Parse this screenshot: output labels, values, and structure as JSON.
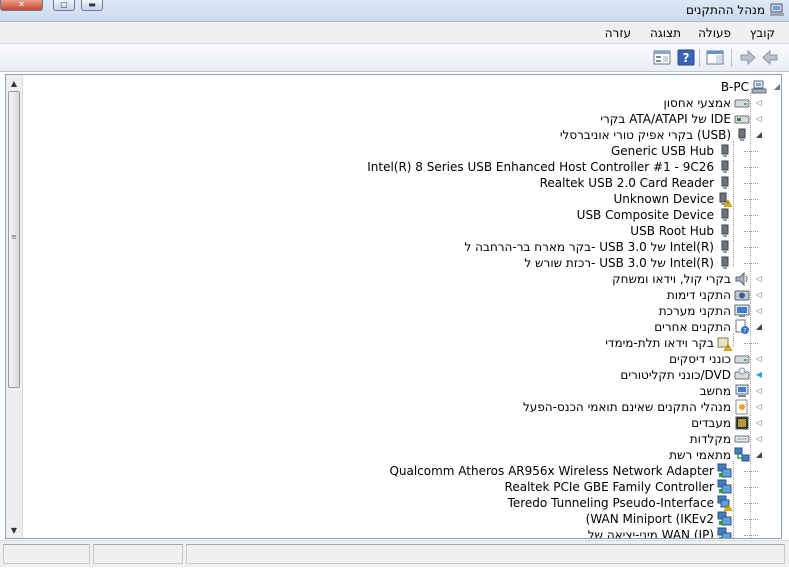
{
  "window": {
    "title": "מנהל ההתקנים",
    "icons": {
      "app": "device-manager-icon",
      "close": "close-icon",
      "maximize": "maximize-icon",
      "minimize": "minimize-icon"
    }
  },
  "menu": {
    "file": "קובץ",
    "action": "פעולה",
    "view": "תצוגה",
    "help": "עזרה"
  },
  "toolbar": {
    "icons": [
      "back-arrow-icon",
      "forward-arrow-icon",
      "properties-icon",
      "help-icon",
      "show-hide-console-tree-icon"
    ]
  },
  "tree": {
    "root": "B-PC",
    "items": [
      {
        "label": "אמצעי אחסון",
        "icon": "storage-icon",
        "expander": "collapsed"
      },
      {
        "label": "בקרי ATA/ATAPI של IDE",
        "icon": "ide-controller-icon",
        "expander": "collapsed"
      },
      {
        "label": "בקרי אפיק טורי אוניברסלי (USB)",
        "icon": "usb-icon",
        "expander": "expanded"
      },
      {
        "label": "Generic USB Hub",
        "icon": "usb-device-icon",
        "expander": "none",
        "child": true
      },
      {
        "label": "Intel(R) 8 Series USB Enhanced Host Controller #1 - 9C26",
        "icon": "usb-device-icon",
        "expander": "none",
        "child": true
      },
      {
        "label": "Realtek USB 2.0 Card Reader",
        "icon": "usb-device-icon",
        "expander": "none",
        "child": true
      },
      {
        "label": "Unknown Device",
        "icon": "usb-warning-icon",
        "expander": "none",
        "child": true
      },
      {
        "label": "USB Composite Device",
        "icon": "usb-device-icon",
        "expander": "none",
        "child": true
      },
      {
        "label": "USB Root Hub",
        "icon": "usb-device-icon",
        "expander": "none",
        "child": true
      },
      {
        "label": "בקר מארח בר-הרחבה ל- USB 3.0 של Intel(R)",
        "icon": "usb-device-icon",
        "expander": "none",
        "child": true
      },
      {
        "label": "רכזת שורש ל- USB 3.0 של Intel(R)",
        "icon": "usb-device-icon",
        "expander": "none",
        "child": true
      },
      {
        "label": "בקרי קול, וידאו ומשחק",
        "icon": "speaker-icon",
        "expander": "collapsed"
      },
      {
        "label": "התקני דימות",
        "icon": "imaging-device-icon",
        "expander": "collapsed"
      },
      {
        "label": "התקני מערכת",
        "icon": "system-device-icon",
        "expander": "collapsed"
      },
      {
        "label": "התקנים אחרים",
        "icon": "other-devices-icon",
        "expander": "expanded"
      },
      {
        "label": "בקר וידאו תלת-מימדי",
        "icon": "warning-device-icon",
        "expander": "none",
        "child": true
      },
      {
        "label": "כונני דיסקים",
        "icon": "disk-drive-icon",
        "expander": "collapsed"
      },
      {
        "label": "כונני תקליטורים/DVD",
        "icon": "dvd-drive-icon",
        "expander": "collapsed-highlight"
      },
      {
        "label": "מחשב",
        "icon": "computer-icon",
        "expander": "collapsed"
      },
      {
        "label": "מנהלי התקנים שאינם תואמי הכנס-הפעל",
        "icon": "non-pnp-driver-icon",
        "expander": "collapsed"
      },
      {
        "label": "מעבדים",
        "icon": "processor-icon",
        "expander": "collapsed"
      },
      {
        "label": "מקלדות",
        "icon": "keyboard-icon",
        "expander": "collapsed"
      },
      {
        "label": "מתאמי רשת",
        "icon": "network-adapter-icon",
        "expander": "expanded"
      },
      {
        "label": "Qualcomm Atheros AR956x Wireless Network Adapter",
        "icon": "network-device-icon",
        "expander": "none",
        "child": true
      },
      {
        "label": "Realtek PCIe GBE Family Controller",
        "icon": "network-device-icon",
        "expander": "none",
        "child": true
      },
      {
        "label": "Teredo Tunneling Pseudo-Interface",
        "icon": "network-warning-icon",
        "expander": "none",
        "child": true
      },
      {
        "label": "(WAN Miniport (IKEv2",
        "icon": "network-device-icon",
        "expander": "none",
        "child": true
      },
      {
        "label": "מיני-יציאה של WAN (IP)",
        "icon": "network-device-icon",
        "expander": "none",
        "child": true
      }
    ]
  },
  "colors": {
    "titlebar": "#c9d9ee",
    "close_button": "#c8452c",
    "highlight_expander": "#1fa6e0"
  }
}
